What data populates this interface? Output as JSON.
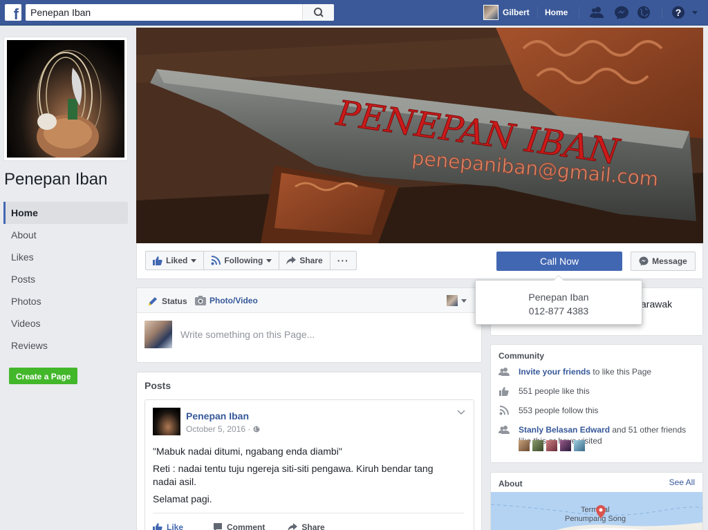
{
  "topbar": {
    "logo_letter": "f",
    "search_value": "Penepan Iban",
    "user_name": "Gilbert",
    "home_label": "Home"
  },
  "page": {
    "name": "Penepan Iban"
  },
  "nav": {
    "items": [
      {
        "label": "Home",
        "active": true
      },
      {
        "label": "About"
      },
      {
        "label": "Likes"
      },
      {
        "label": "Posts"
      },
      {
        "label": "Photos"
      },
      {
        "label": "Videos"
      },
      {
        "label": "Reviews"
      }
    ],
    "create_page": "Create a Page"
  },
  "cover": {
    "title": "PENEPAN IBAN",
    "email": "penepaniban@gmail.com"
  },
  "actions": {
    "liked": "Liked",
    "following": "Following",
    "share": "Share",
    "more": "···",
    "call_now": "Call Now",
    "message": "Message"
  },
  "tooltip": {
    "name": "Penepan Iban",
    "phone": "012-877 4383"
  },
  "composer": {
    "status_tab": "Status",
    "photo_tab": "Photo/Video",
    "placeholder": "Write something on this Page..."
  },
  "posts": {
    "title": "Posts",
    "post": {
      "author": "Penepan Iban",
      "date": "October 5, 2016 ·",
      "lines": [
        "\"Mabuk nadai ditumi, ngabang enda diambi\"",
        "Reti : nadai tentu tuju ngereja siti-siti pengawa. Kiruh bendar tang nadai asil.",
        "Selamat pagi."
      ],
      "like": "Like",
      "comment": "Comment",
      "share": "Share"
    }
  },
  "about_snippet": "arawak",
  "community": {
    "title": "Community",
    "invite_link": "Invite your friends",
    "invite_rest": " to like this Page",
    "likes": "551 people like this",
    "follows": "553 people follow this",
    "friend_link": "Stanly Belasan Edward",
    "friend_rest": " and 51 other friends like this or have visited"
  },
  "about": {
    "title": "About",
    "see_all": "See All",
    "map_label_1": "Terminal",
    "map_label_2": "Penumpang Song"
  },
  "colors": {
    "fb_blue": "#3b5998",
    "button_blue": "#4267b2",
    "link_blue": "#365899",
    "create_green": "#42b72a"
  }
}
